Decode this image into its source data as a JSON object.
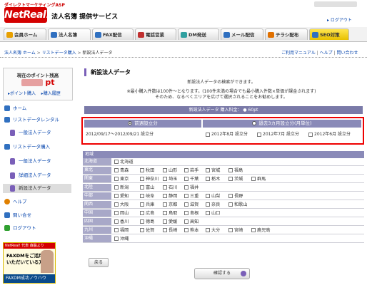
{
  "header": {
    "tagline": "ダイレクトマーケティングASP",
    "logo": "NetReal!",
    "service_title": "法人名簿 提供サービス",
    "logout": "ログアウト"
  },
  "nav": {
    "tabs": [
      {
        "label": "会員ホーム",
        "icon": "home-icon",
        "color": "#e8a000"
      },
      {
        "label": "法人名簿",
        "icon": "list-icon",
        "color": "#3070c0"
      },
      {
        "label": "FAX配信",
        "icon": "fax-icon",
        "color": "#3070c0"
      },
      {
        "label": "電話営業",
        "icon": "phone-icon",
        "color": "#c03030"
      },
      {
        "label": "DM発送",
        "icon": "mail-icon",
        "color": "#30a0a0"
      },
      {
        "label": "メール配信",
        "icon": "email-icon",
        "color": "#3070c0"
      },
      {
        "label": "チラシ配布",
        "icon": "flyer-icon",
        "color": "#e07000"
      },
      {
        "label": "SEO対策",
        "icon": "seo-icon",
        "color": "#3070c0"
      }
    ]
  },
  "breadcrumb": {
    "items": [
      "法人名簿 ホーム",
      "リストデータ購入",
      "新設法人データ"
    ],
    "sep": " > "
  },
  "help_links": {
    "manual": "ご利用マニュアル",
    "help": "ヘルプ",
    "contact": "問い合わせ",
    "sep": " | "
  },
  "points": {
    "label": "現在のポイント残高",
    "unit": "pt",
    "buy": "ポイント購入",
    "history": "購入履歴"
  },
  "sidebar": {
    "items": [
      {
        "label": "ホーム",
        "icon": "home-icon",
        "sub": false
      },
      {
        "label": "リストデータレンタル",
        "icon": "rental-icon",
        "sub": false
      },
      {
        "label": "一般法人データ",
        "icon": "doc-icon",
        "sub": true
      },
      {
        "label": "リストデータ購入",
        "icon": "buy-icon",
        "sub": false
      },
      {
        "label": "一般法人データ",
        "icon": "doc-icon",
        "sub": true
      },
      {
        "label": "詳細法人データ",
        "icon": "doc-icon",
        "sub": true
      },
      {
        "label": "新設法人データ",
        "icon": "doc-icon",
        "sub": true,
        "active": true
      },
      {
        "label": "ヘルプ",
        "icon": "help-icon",
        "sub": false
      },
      {
        "label": "問い合せ",
        "icon": "contact-icon",
        "sub": false
      },
      {
        "label": "ログアウト",
        "icon": "logout-icon",
        "sub": false
      }
    ]
  },
  "banner": {
    "tag": "NetReal! 代表 森脇より",
    "text": "FAXDMをご活用\nいただいている方へ",
    "strip": "FAXDM成功ノウハウ"
  },
  "main": {
    "title": "新設法人データ",
    "desc1": "新設法人データの検索ができます。",
    "desc2": "※最小購入件数は100件～となります。(100件未満の場合でも最小購入件数×単価が課金されます)",
    "desc3": "そのため、なるべくエリアを広げて選択されることをお勧めします。",
    "purchase_bar": "新設法人データ 購入料金： ● 60pt"
  },
  "period": {
    "recent_label": "前週設立分",
    "recent_range": "2012/09/17～2012/09/21 設立分",
    "past_label": "過去3カ月設立分(月単位)",
    "months": [
      "2012年8月 設立分",
      "2012年7月 設立分",
      "2012年6月 設立分"
    ]
  },
  "area": {
    "header": "地域",
    "regions": [
      {
        "name": "北海道",
        "prefs": [
          "北海道"
        ]
      },
      {
        "name": "東北",
        "prefs": [
          "青森",
          "秋田",
          "山形",
          "岩手",
          "宮城",
          "福島"
        ]
      },
      {
        "name": "関東",
        "prefs": [
          "東京",
          "神奈川",
          "埼玉",
          "千葉",
          "栃木",
          "茨城",
          "群馬"
        ]
      },
      {
        "name": "北陸",
        "prefs": [
          "新潟",
          "富山",
          "石川",
          "福井"
        ]
      },
      {
        "name": "中部",
        "prefs": [
          "愛知",
          "岐阜",
          "静岡",
          "三重",
          "山梨",
          "長野"
        ]
      },
      {
        "name": "関西",
        "prefs": [
          "大阪",
          "兵庫",
          "京都",
          "滋賀",
          "奈良",
          "和歌山"
        ]
      },
      {
        "name": "中国",
        "prefs": [
          "岡山",
          "広島",
          "鳥取",
          "島根",
          "山口"
        ]
      },
      {
        "name": "四国",
        "prefs": [
          "香川",
          "徳島",
          "愛媛",
          "高知"
        ]
      },
      {
        "name": "九州",
        "prefs": [
          "福岡",
          "佐賀",
          "長崎",
          "熊本",
          "大分",
          "宮崎",
          "鹿児島"
        ]
      },
      {
        "name": "沖縄",
        "prefs": [
          "沖縄"
        ]
      }
    ]
  },
  "buttons": {
    "back": "戻る",
    "confirm": "確認する"
  }
}
